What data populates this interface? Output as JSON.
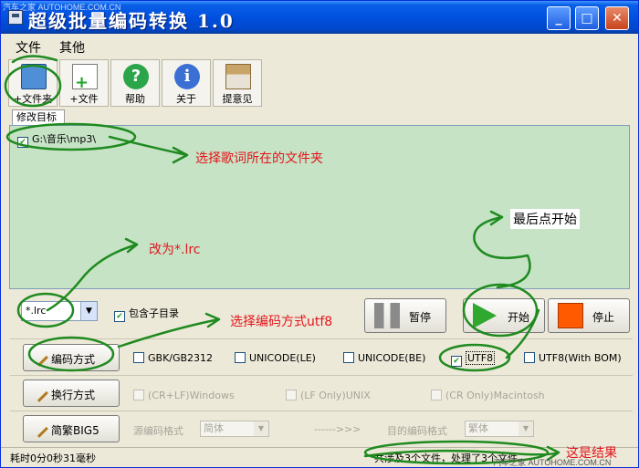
{
  "window": {
    "title": "超级批量编码转换 1.0",
    "watermark_top": "汽车之家 AUTOHOME.COM.CN",
    "controls": [
      "_",
      "□",
      "✕"
    ]
  },
  "menu": {
    "items": [
      "文件",
      "其他"
    ]
  },
  "toolbar": {
    "buttons": [
      {
        "label": "+文件夹",
        "icon": "folder-add-icon"
      },
      {
        "label": "+文件",
        "icon": "file-add-icon"
      },
      {
        "label": "帮助",
        "icon": "help-icon"
      },
      {
        "label": "关于",
        "icon": "info-icon"
      },
      {
        "label": "提意见",
        "icon": "house-icon"
      }
    ]
  },
  "targets": {
    "tab_label": "修改目标",
    "items": [
      {
        "path": "G:\\音乐\\mp3\\",
        "checked": true
      }
    ]
  },
  "filter": {
    "pattern": "*.lrc",
    "include_subdirs_label": "包含子目录",
    "include_subdirs_checked": true
  },
  "actions": {
    "pause": "暂停",
    "start": "开始",
    "stop": "停止"
  },
  "encoding": {
    "button": "编码方式",
    "options": [
      {
        "label": "GBK/GB2312",
        "checked": false
      },
      {
        "label": "UNICODE(LE)",
        "checked": false
      },
      {
        "label": "UNICODE(BE)",
        "checked": false
      },
      {
        "label": "UTF8",
        "checked": true
      },
      {
        "label": "UTF8(With BOM)",
        "checked": false
      }
    ]
  },
  "line_ending": {
    "button": "换行方式",
    "options": [
      "(CR+LF)Windows",
      "(LF Only)UNIX",
      "(CR Only)Macintosh"
    ]
  },
  "conversion": {
    "button": "简繁BIG5",
    "source_label": "源编码格式",
    "source_value": "简体",
    "arrow": "------>>>",
    "target_label": "目的编码格式",
    "target_value": "繁体"
  },
  "status": {
    "left": "耗时0分0秒31毫秒",
    "right": "共涉及3个文件，处理了3个文件"
  },
  "watermark_bottom": "汽车之家 AUTOHOME.COM.CN",
  "annotations": {
    "select_folder": "选择歌词所在的文件夹",
    "change_filter": "改为*.lrc",
    "choose_encoding": "选择编码方式utf8",
    "click_start": "最后点开始",
    "result": "这是结果"
  },
  "colors": {
    "titlebar": "#0050e0",
    "panel_green": "#c6e3c6",
    "annotation_red": "#e4141b",
    "ink_green": "#1f8a1f",
    "start_green": "#2fa830",
    "stop_orange": "#ff5a00"
  }
}
